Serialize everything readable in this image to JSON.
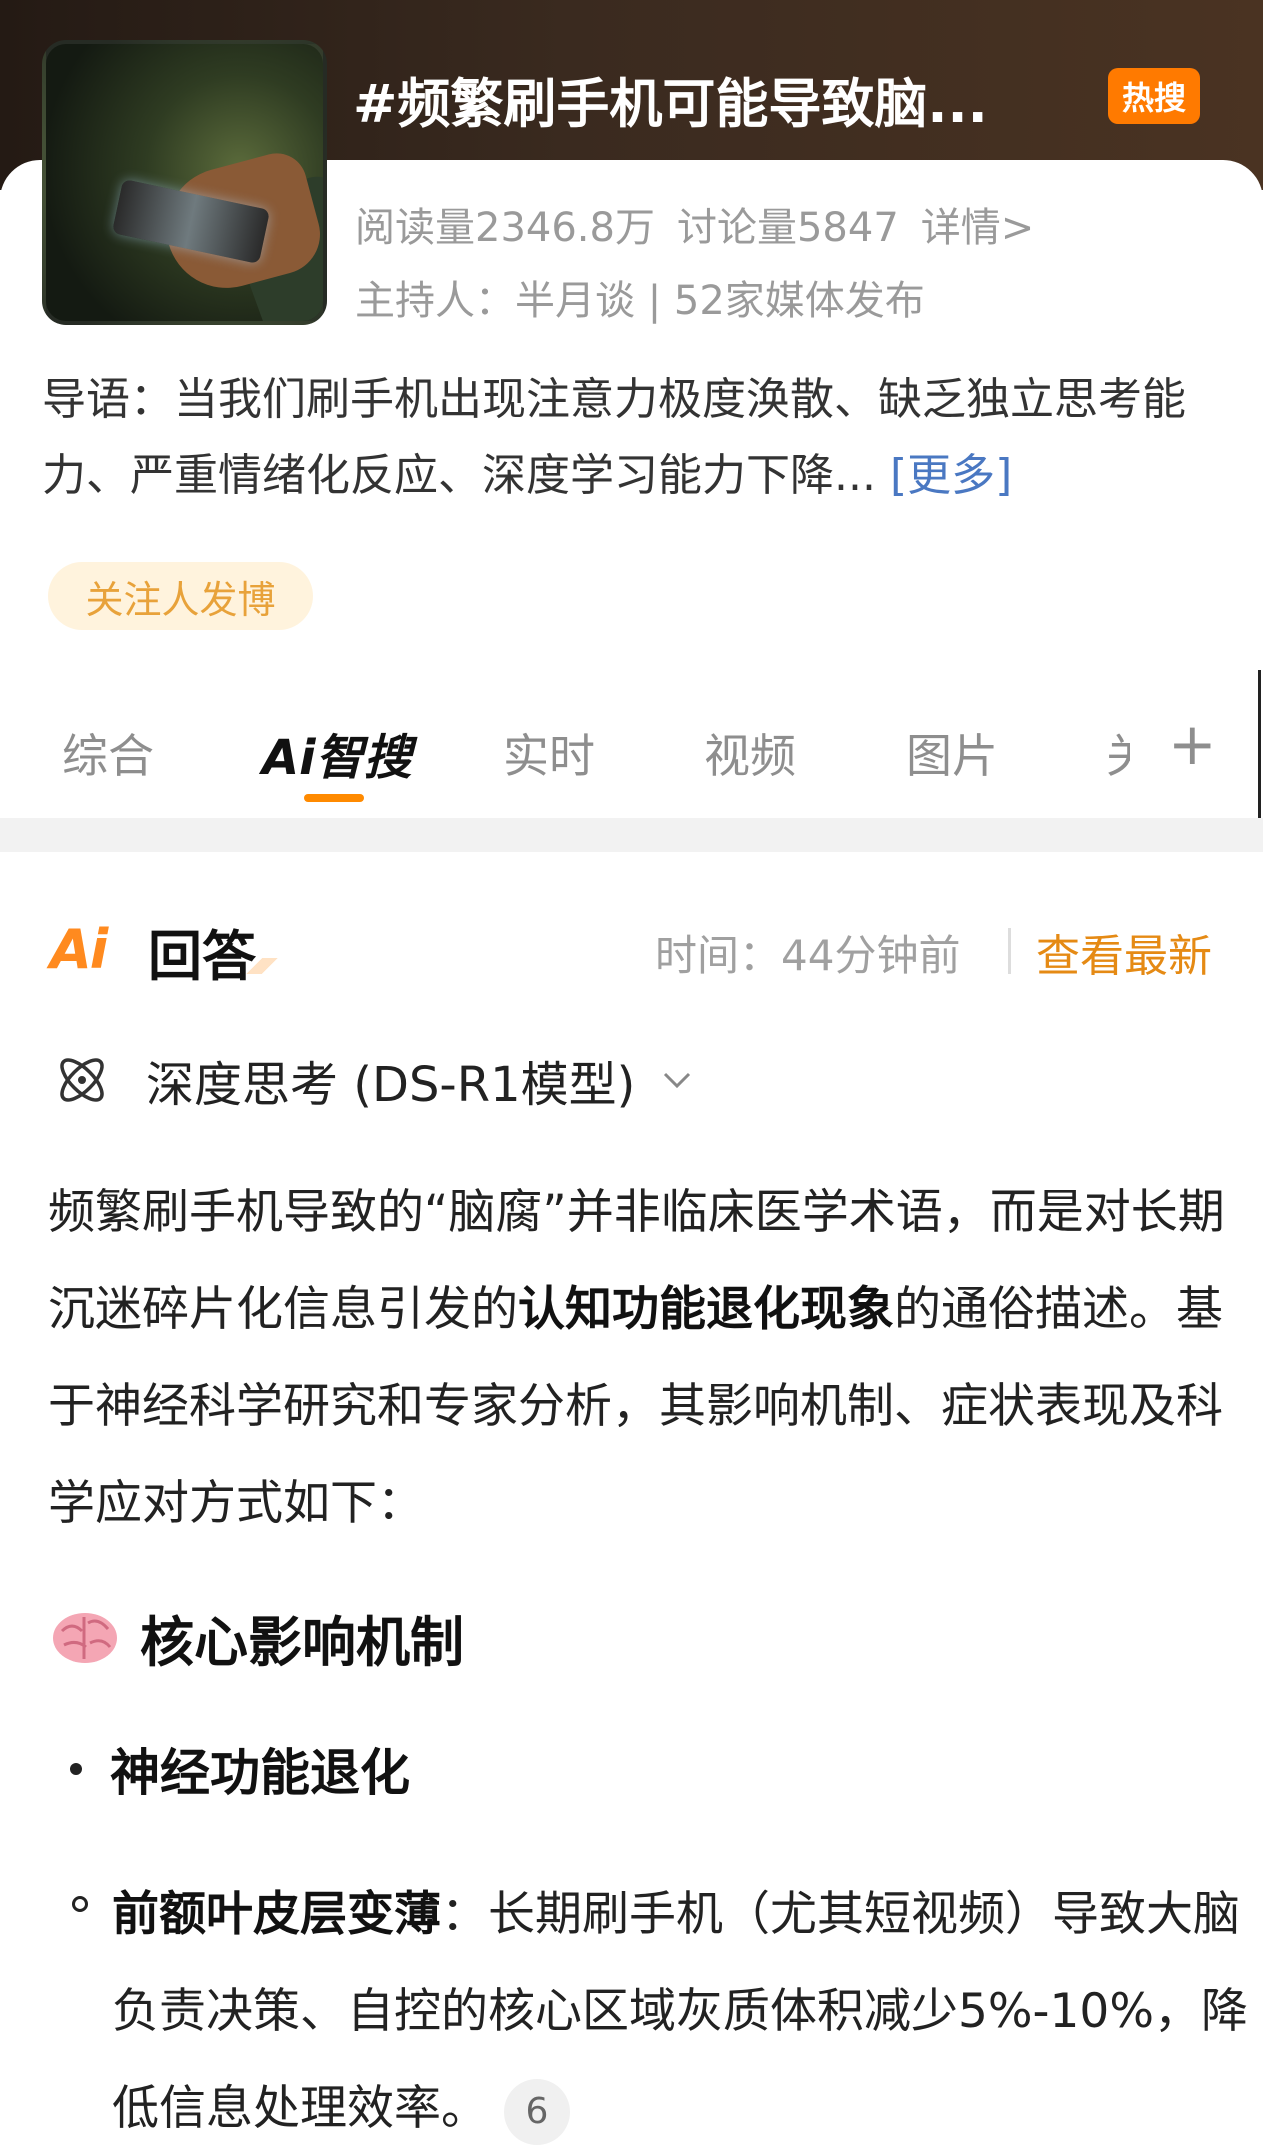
{
  "topic": {
    "title": "#频繁刷手机可能导致脑...",
    "hot_badge": "热搜",
    "reads": "阅读量2346.8万",
    "discussions": "讨论量5847",
    "details": "详情>",
    "host": "主持人：半月谈 | 52家媒体发布",
    "intro_text": "导语：当我们刷手机出现注意力极度涣散、缺乏独立思考能力、严重情绪化反应、深度学习能力下降...",
    "intro_more": "[更多]",
    "follow_button": "关注人发博"
  },
  "tabs": {
    "items": [
      "综合",
      "Ai智搜",
      "实时",
      "视频",
      "图片",
      "关"
    ],
    "active": "Ai智搜",
    "add_icon": "plus-icon"
  },
  "answer": {
    "logo": "Ai",
    "title": "回答",
    "time": "时间：44分钟前",
    "latest": "查看最新",
    "model": "深度思考 (DS-R1模型)",
    "p1_a": "频繁刷手机导致的“脑腐”并非临床医学术语，而是对长期沉迷碎片化信息引发的",
    "p1_bold": "认知功能退化现象",
    "p1_b": "的通俗描述。基于神经科学研究和专家分析，其影响机制、症状表现及科学应对方式如下：",
    "section_title": "核心影响机制",
    "bullet1": "神经功能退化",
    "sub_bold": "前额叶皮层变薄",
    "sub_text": "：长期刷手机（尤其短视频）导致大脑负责决策、自控的核心区域灰质体积减少5%-10%，降低信息处理效率。",
    "citation": "6"
  },
  "colors": {
    "accent_orange": "#ff8a00",
    "hot_badge": "#ff7a00",
    "link_blue": "#4a78c2",
    "latest_orange": "#e58a14"
  }
}
